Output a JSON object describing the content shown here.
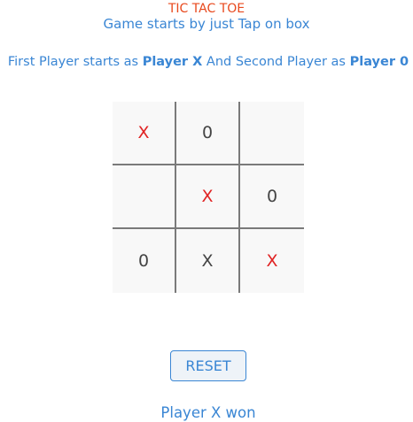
{
  "header": {
    "title": "TIC TAC TOE",
    "subtitle": "Game starts by just Tap on box"
  },
  "instructions": {
    "part1": "First Player starts as ",
    "player1": "Player X",
    "part2": " And Second Player as ",
    "player2": "Player 0"
  },
  "board": {
    "cells": [
      [
        "X",
        "0",
        ""
      ],
      [
        "",
        "X",
        "0"
      ],
      [
        "0",
        "X",
        "X"
      ]
    ]
  },
  "colors": {
    "title": "#e8491d",
    "accent": "#3a86d4",
    "x_highlight": "#e02424",
    "mark_default": "#444444"
  },
  "controls": {
    "reset_label": "RESET"
  },
  "status": {
    "text": "Player X won"
  }
}
